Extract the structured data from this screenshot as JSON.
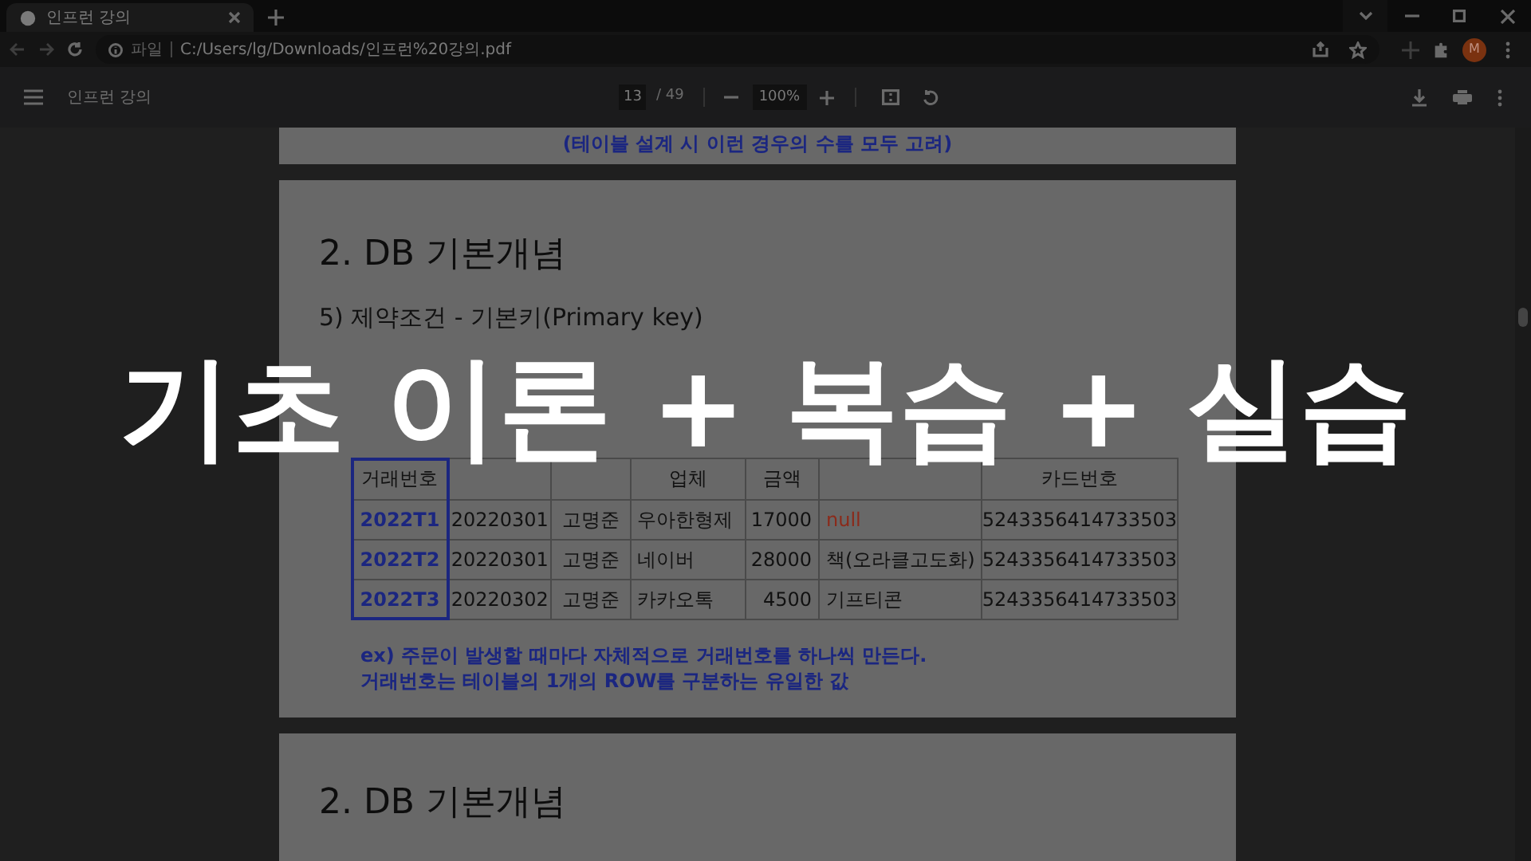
{
  "browser": {
    "tab": {
      "title": "인프런 강의",
      "selected": true
    },
    "address": {
      "security_label": "파일",
      "url": "C:/Users/lg/Downloads/인프런%20강의.pdf"
    },
    "profile_initial": "M"
  },
  "pdf_toolbar": {
    "title": "인프런 강의",
    "page": "13",
    "page_total": "/ 49",
    "zoom": "100%"
  },
  "pages": [
    {
      "kind": "tail",
      "note": "(테이블 설계 시 이런 경우의 수를 모두 고려)"
    },
    {
      "kind": "slide",
      "heading": "2. DB 기본개념",
      "subheading": "5) 제약조건 - 기본키(Primary key)",
      "table": {
        "columns": [
          "거래번호",
          null,
          null,
          "업체",
          "금액",
          null,
          "카드번호"
        ],
        "rows": [
          {
            "cells": [
              {
                "text": "2022T1",
                "kind": "key"
              },
              {
                "text": "20220301",
                "kind": "value"
              },
              {
                "text": "고명준",
                "kind": "value"
              },
              {
                "text": "우아한형제",
                "kind": "value"
              },
              {
                "text": "17000",
                "kind": "value"
              },
              {
                "text": "null",
                "kind": "null"
              },
              {
                "text": "5243356414733503",
                "kind": "value"
              }
            ]
          },
          {
            "cells": [
              {
                "text": "2022T2",
                "kind": "key"
              },
              {
                "text": "20220301",
                "kind": "value"
              },
              {
                "text": "고명준",
                "kind": "value"
              },
              {
                "text": "네이버",
                "kind": "value"
              },
              {
                "text": "28000",
                "kind": "value"
              },
              {
                "text": "책(오라클고도화)",
                "kind": "value"
              },
              {
                "text": "5243356414733503",
                "kind": "value"
              }
            ]
          },
          {
            "cells": [
              {
                "text": "2022T3",
                "kind": "key"
              },
              {
                "text": "20220302",
                "kind": "value"
              },
              {
                "text": "고명준",
                "kind": "value"
              },
              {
                "text": "카카오톡",
                "kind": "value"
              },
              {
                "text": "4500",
                "kind": "value"
              },
              {
                "text": "기프티콘",
                "kind": "value"
              },
              {
                "text": "5243356414733503",
                "kind": "value"
              }
            ]
          }
        ]
      },
      "notes": [
        "ex) 주문이 발생할 때마다 자체적으로 거래번호를 하나씩 만든다.",
        "거래번호는 테이블의 1개의 ROW를 구분하는 유일한 값"
      ]
    },
    {
      "kind": "slide",
      "heading": "2. DB 기본개념"
    }
  ],
  "overlay_caption": "기초 이론 + 복습 + 실습"
}
